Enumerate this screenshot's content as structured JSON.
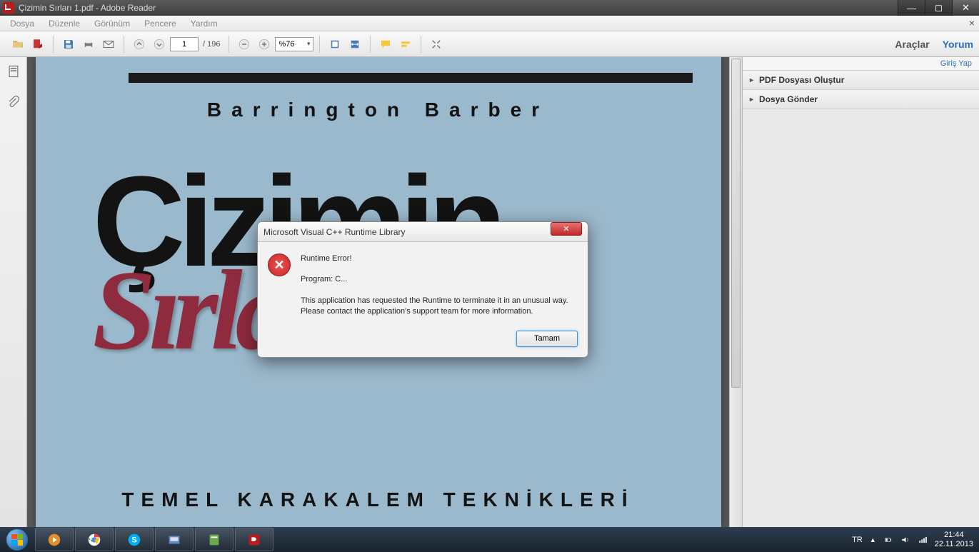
{
  "window": {
    "title": "Çizimin Sırları 1.pdf - Adobe Reader"
  },
  "menu": {
    "items": [
      "Dosya",
      "Düzenle",
      "Görünüm",
      "Pencere",
      "Yardım"
    ]
  },
  "toolbar": {
    "page_current": "1",
    "page_total": "/ 196",
    "zoom": "%76",
    "right_tools": "Araçlar",
    "right_comment": "Yorum"
  },
  "right_panel": {
    "login": "Giriş Yap",
    "items": [
      "PDF Dosyası Oluştur",
      "Dosya Gönder"
    ]
  },
  "document": {
    "author": "Barrington Barber",
    "title_line1": "Çizimin",
    "title_line2": "Sırları",
    "subtitle": "TEMEL KARAKALEM TEKNİKLERİ"
  },
  "dialog": {
    "title": "Microsoft Visual C++ Runtime Library",
    "heading": "Runtime Error!",
    "program": "Program: C...",
    "message1": "This application has requested the Runtime to terminate it in an unusual way.",
    "message2": "Please contact the application's support team for more information.",
    "ok": "Tamam"
  },
  "taskbar": {
    "lang": "TR",
    "time": "21:44",
    "date": "22.11.2013"
  }
}
